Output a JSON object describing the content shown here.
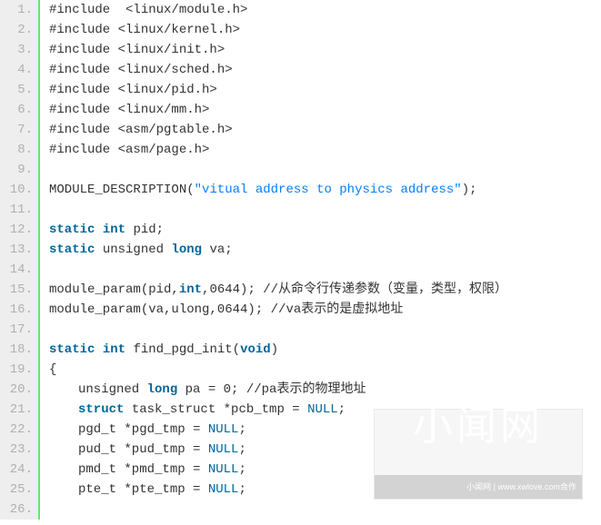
{
  "watermark": {
    "text": "小闻网",
    "footer": "小闻网 | www.xwlove.com合作"
  },
  "lines": [
    {
      "n": "1.",
      "tokens": [
        {
          "t": "#include  <linux/module.h>"
        }
      ]
    },
    {
      "n": "2.",
      "tokens": [
        {
          "t": "#include <linux/kernel.h>"
        }
      ]
    },
    {
      "n": "3.",
      "tokens": [
        {
          "t": "#include <linux/init.h>"
        }
      ]
    },
    {
      "n": "4.",
      "tokens": [
        {
          "t": "#include <linux/sched.h>"
        }
      ]
    },
    {
      "n": "5.",
      "tokens": [
        {
          "t": "#include <linux/pid.h>"
        }
      ]
    },
    {
      "n": "6.",
      "tokens": [
        {
          "t": "#include <linux/mm.h>"
        }
      ]
    },
    {
      "n": "7.",
      "tokens": [
        {
          "t": "#include <asm/pgtable.h>"
        }
      ]
    },
    {
      "n": "8.",
      "tokens": [
        {
          "t": "#include <asm/page.h>"
        }
      ]
    },
    {
      "n": "9.",
      "tokens": []
    },
    {
      "n": "10.",
      "tokens": [
        {
          "t": "MODULE_DESCRIPTION("
        },
        {
          "t": "\"vitual address to physics address\"",
          "c": "str"
        },
        {
          "t": ");"
        }
      ]
    },
    {
      "n": "11.",
      "tokens": []
    },
    {
      "n": "12.",
      "tokens": [
        {
          "t": "static",
          "c": "kw"
        },
        {
          "t": " "
        },
        {
          "t": "int",
          "c": "kw"
        },
        {
          "t": " pid;"
        }
      ]
    },
    {
      "n": "13.",
      "tokens": [
        {
          "t": "static",
          "c": "kw"
        },
        {
          "t": " unsigned "
        },
        {
          "t": "long",
          "c": "kw"
        },
        {
          "t": " va;"
        }
      ]
    },
    {
      "n": "14.",
      "tokens": []
    },
    {
      "n": "15.",
      "tokens": [
        {
          "t": "module_param(pid,"
        },
        {
          "t": "int",
          "c": "kw"
        },
        {
          "t": ",0644); //从命令行传递参数（变量，类型，权限）"
        }
      ]
    },
    {
      "n": "16.",
      "tokens": [
        {
          "t": "module_param(va,ulong,0644); //va表示的是虚拟地址"
        }
      ]
    },
    {
      "n": "17.",
      "tokens": []
    },
    {
      "n": "18.",
      "tokens": [
        {
          "t": "static",
          "c": "kw"
        },
        {
          "t": " "
        },
        {
          "t": "int",
          "c": "kw"
        },
        {
          "t": " find_pgd_init("
        },
        {
          "t": "void",
          "c": "kw"
        },
        {
          "t": ")"
        }
      ]
    },
    {
      "n": "19.",
      "tokens": [
        {
          "t": "{"
        }
      ]
    },
    {
      "n": "20.",
      "indent": 2,
      "tokens": [
        {
          "t": "unsigned "
        },
        {
          "t": "long",
          "c": "kw"
        },
        {
          "t": " pa = 0; //pa表示的物理地址"
        }
      ]
    },
    {
      "n": "21.",
      "indent": 2,
      "tokens": [
        {
          "t": "struct",
          "c": "kw"
        },
        {
          "t": " task_struct *pcb_tmp = "
        },
        {
          "t": "NULL",
          "c": "const"
        },
        {
          "t": ";"
        }
      ]
    },
    {
      "n": "22.",
      "indent": 2,
      "tokens": [
        {
          "t": "pgd_t *pgd_tmp = "
        },
        {
          "t": "NULL",
          "c": "const"
        },
        {
          "t": ";"
        }
      ]
    },
    {
      "n": "23.",
      "indent": 2,
      "tokens": [
        {
          "t": "pud_t *pud_tmp = "
        },
        {
          "t": "NULL",
          "c": "const"
        },
        {
          "t": ";"
        }
      ]
    },
    {
      "n": "24.",
      "indent": 2,
      "tokens": [
        {
          "t": "pmd_t *pmd_tmp = "
        },
        {
          "t": "NULL",
          "c": "const"
        },
        {
          "t": ";"
        }
      ]
    },
    {
      "n": "25.",
      "indent": 2,
      "tokens": [
        {
          "t": "pte_t *pte_tmp = "
        },
        {
          "t": "NULL",
          "c": "const"
        },
        {
          "t": ";"
        }
      ]
    },
    {
      "n": "26.",
      "tokens": []
    }
  ]
}
